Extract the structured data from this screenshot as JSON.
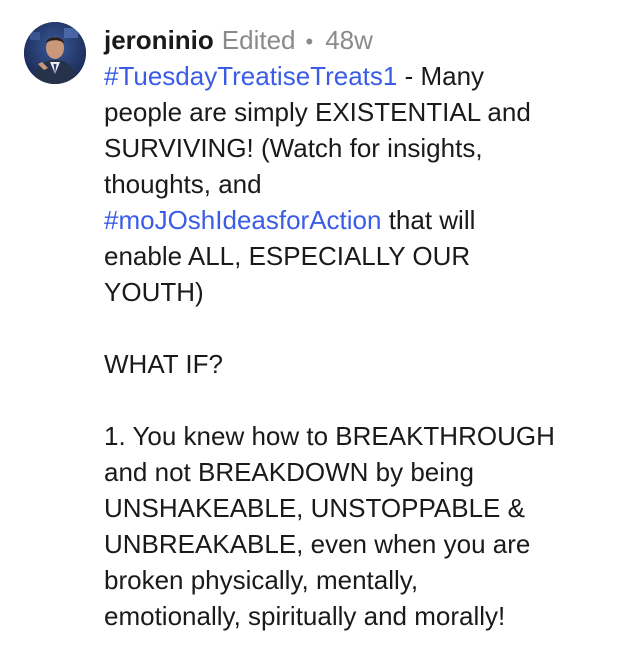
{
  "comment": {
    "username": "jeroninio",
    "edited_label": "Edited",
    "separator": "•",
    "age": "48w",
    "avatar": "profile-photo-man-in-suit-speaking",
    "hashtag_color": "#3b5ce6",
    "text_color": "#1a1a1a",
    "meta_color": "#8a8a8a",
    "line1": {
      "hashtag": "#TuesdayTreatiseTreats1",
      "rest": " - Many"
    },
    "line2": "people are simply EXISTENTIAL and",
    "line3": "SURVIVING! (Watch for insights,",
    "line4": "thoughts, and",
    "line5": {
      "hashtag": "#moJOshIdeasforAction",
      "rest": " that will"
    },
    "line6": "enable ALL, ESPECIALLY OUR",
    "line7": "YOUTH)",
    "line9": "WHAT IF?",
    "line11": "1. You knew how to BREAKTHROUGH",
    "line12": "and not BREAKDOWN by being",
    "line13": "UNSHAKEABLE, UNSTOPPABLE &",
    "line14": "UNBREAKABLE, even when you are",
    "line15": "broken physically, mentally,",
    "line16": "emotionally, spiritually and morally!"
  }
}
